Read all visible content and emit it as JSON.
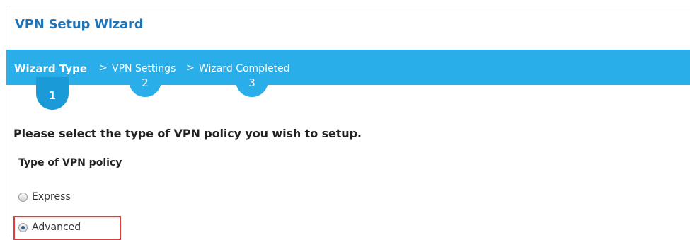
{
  "window": {
    "title": "VPN Setup Wizard"
  },
  "steps": [
    {
      "label": "Wizard Type",
      "number": "1",
      "active": true
    },
    {
      "label": "VPN Settings",
      "number": "2",
      "active": false
    },
    {
      "label": "Wizard Completed",
      "number": "3",
      "active": false
    }
  ],
  "step_separator": ">",
  "form": {
    "heading": "Please select the type of VPN policy you wish to setup.",
    "group_label": "Type of VPN policy",
    "options": [
      {
        "label": "Express",
        "checked": false
      },
      {
        "label": "Advanced",
        "checked": true
      }
    ]
  },
  "colors": {
    "title": "#1f73b7",
    "steps_bar": "#2aaeea",
    "highlight": "#e23b3b"
  }
}
